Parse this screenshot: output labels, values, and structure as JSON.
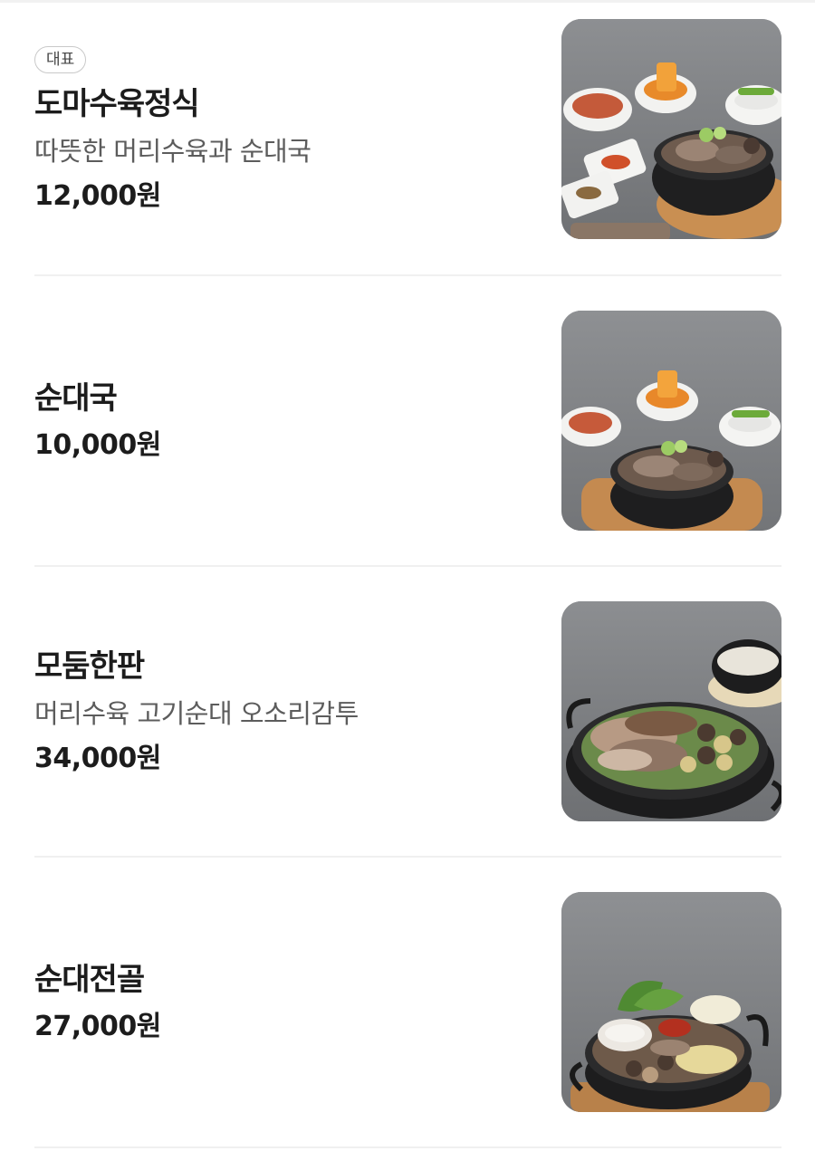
{
  "menu": {
    "items": [
      {
        "badge": "대표",
        "name": "도마수육정식",
        "description": "따뜻한 머리수육과 순대국",
        "price": "12,000원",
        "image": "food-photo-suyuk-set"
      },
      {
        "badge": "",
        "name": "순대국",
        "description": "",
        "price": "10,000원",
        "image": "food-photo-sundaeguk"
      },
      {
        "badge": "",
        "name": "모둠한판",
        "description": "머리수육 고기순대 오소리감투",
        "price": "34,000원",
        "image": "food-photo-platter"
      },
      {
        "badge": "",
        "name": "순대전골",
        "description": "",
        "price": "27,000원",
        "image": "food-photo-hotpot"
      }
    ]
  },
  "colors": {
    "text_primary": "#1c1c1c",
    "text_secondary": "#5c5c5c",
    "divider": "#f0f0f0",
    "badge_border": "#c9c9c9"
  }
}
